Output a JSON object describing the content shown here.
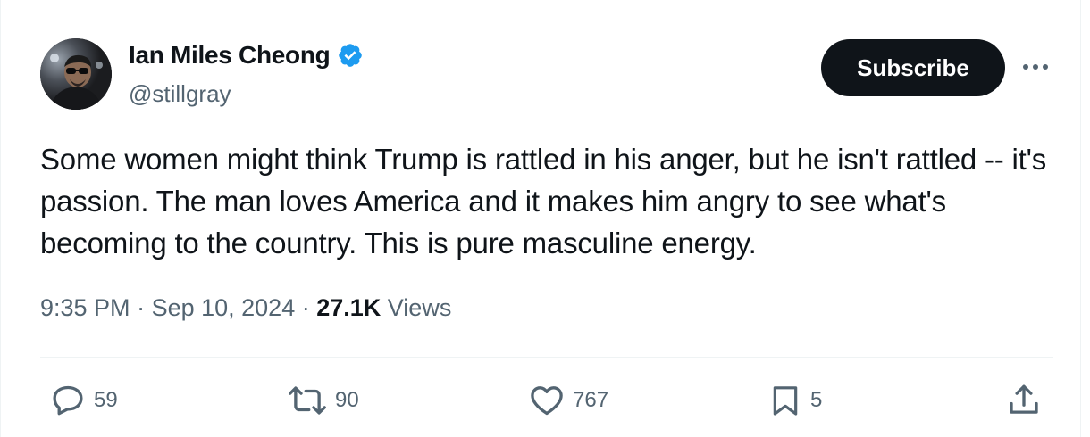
{
  "author": {
    "display_name": "Ian Miles Cheong",
    "handle": "@stillgray",
    "verified": true
  },
  "header": {
    "subscribe_label": "Subscribe",
    "more_icon": "more-horizontal-icon"
  },
  "tweet": {
    "text": "Some women might think Trump is rattled in his anger, but he isn't rattled -- it's passion. The man loves America and it makes him angry to see what's becoming to the country. This is pure masculine energy."
  },
  "meta": {
    "time": "9:35 PM",
    "separator": " · ",
    "date": "Sep 10, 2024",
    "views_count": "27.1K",
    "views_label": " Views"
  },
  "actions": {
    "replies": "59",
    "reposts": "90",
    "likes": "767",
    "bookmarks": "5"
  },
  "colors": {
    "text_primary": "#0f1419",
    "text_secondary": "#536471",
    "verified_blue": "#1d9bf0",
    "button_bg": "#0f1419"
  }
}
